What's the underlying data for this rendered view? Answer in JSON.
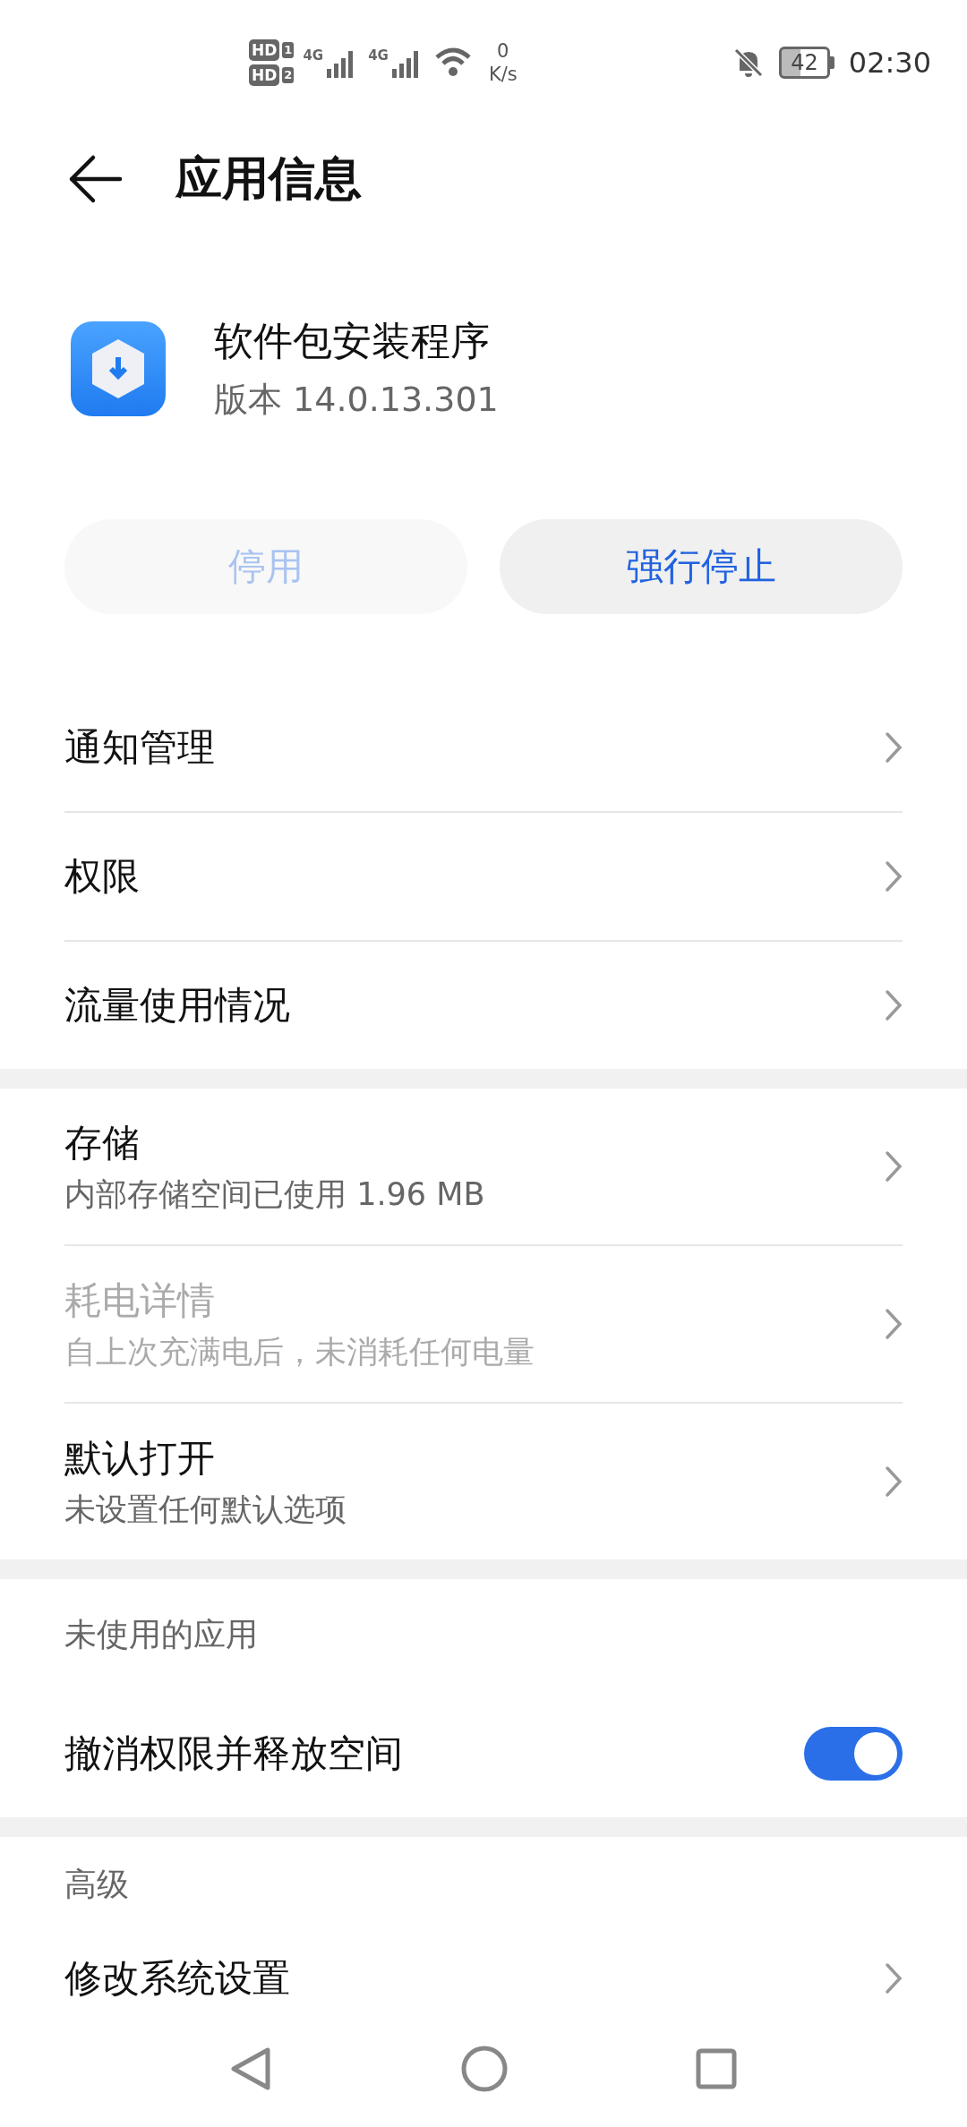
{
  "status_bar": {
    "sims": [
      {
        "label": "HD",
        "slot": "1"
      },
      {
        "label": "HD",
        "slot": "2"
      }
    ],
    "networks": [
      "4G",
      "4G"
    ],
    "speed_value": "0",
    "speed_unit": "K/s",
    "battery": "42",
    "time": "02:30"
  },
  "header": {
    "title": "应用信息"
  },
  "app": {
    "name": "软件包安装程序",
    "version": "版本 14.0.13.301"
  },
  "buttons": [
    {
      "label": "停用",
      "disabled": true
    },
    {
      "label": "强行停止",
      "disabled": false
    }
  ],
  "sections": [
    {
      "items": [
        {
          "kind": "link",
          "title": "通知管理",
          "disabled": false
        },
        {
          "kind": "link",
          "title": "权限",
          "disabled": false
        },
        {
          "kind": "link",
          "title": "流量使用情况",
          "disabled": false
        }
      ]
    },
    {
      "items": [
        {
          "kind": "link",
          "title": "存储",
          "subtitle": "内部存储空间已使用 1.96 MB",
          "disabled": false
        },
        {
          "kind": "link",
          "title": "耗电详情",
          "subtitle": "自上次充满电后，未消耗任何电量",
          "disabled": true
        },
        {
          "kind": "link",
          "title": "默认打开",
          "subtitle": "未设置任何默认选项",
          "disabled": false
        }
      ]
    },
    {
      "header": "未使用的应用",
      "items": [
        {
          "kind": "toggle",
          "title": "撤消权限并释放空间",
          "on": true
        }
      ]
    },
    {
      "header": "高级",
      "items": [
        {
          "kind": "link",
          "title": "修改系统设置",
          "disabled": false
        }
      ]
    }
  ]
}
